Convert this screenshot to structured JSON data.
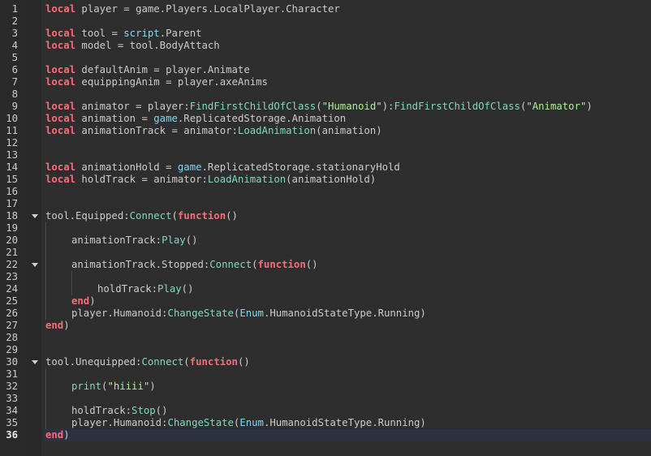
{
  "editor": {
    "current_line": 36,
    "colors": {
      "keyword": "#f86d7c",
      "method": "#84d6c4",
      "builtin": "#84d6f7",
      "string": "#adf195",
      "text": "#cccccc",
      "background": "#2e2e2e"
    },
    "fold_lines": [
      18,
      22,
      30
    ],
    "lines": [
      {
        "n": "1",
        "i": 0,
        "t": [
          [
            "kw",
            "local"
          ],
          [
            "id",
            " player = game.Players.LocalPlayer.Character"
          ]
        ]
      },
      {
        "n": "2",
        "i": 0,
        "t": []
      },
      {
        "n": "3",
        "i": 0,
        "t": [
          [
            "kw",
            "local"
          ],
          [
            "id",
            " tool = "
          ],
          [
            "bi",
            "script"
          ],
          [
            "id",
            ".Parent"
          ]
        ]
      },
      {
        "n": "4",
        "i": 0,
        "t": [
          [
            "kw",
            "local"
          ],
          [
            "id",
            " model = tool.BodyAttach"
          ]
        ]
      },
      {
        "n": "5",
        "i": 0,
        "t": []
      },
      {
        "n": "6",
        "i": 0,
        "t": [
          [
            "kw",
            "local"
          ],
          [
            "id",
            " defaultAnim = player.Animate"
          ]
        ]
      },
      {
        "n": "7",
        "i": 0,
        "t": [
          [
            "kw",
            "local"
          ],
          [
            "id",
            " equippingAnim = player.axeAnims"
          ]
        ]
      },
      {
        "n": "8",
        "i": 0,
        "t": []
      },
      {
        "n": "9",
        "i": 0,
        "t": [
          [
            "kw",
            "local"
          ],
          [
            "id",
            " animator = player:"
          ],
          [
            "fn",
            "FindFirstChildOfClass"
          ],
          [
            "id",
            "("
          ],
          [
            "str",
            "\"Humanoid\""
          ],
          [
            "id",
            "):"
          ],
          [
            "fn",
            "FindFirstChildOfClass"
          ],
          [
            "id",
            "("
          ],
          [
            "str",
            "\"Animator\""
          ],
          [
            "id",
            ")"
          ]
        ]
      },
      {
        "n": "10",
        "i": 0,
        "t": [
          [
            "kw",
            "local"
          ],
          [
            "id",
            " animation = "
          ],
          [
            "bi",
            "game"
          ],
          [
            "id",
            ".ReplicatedStorage.Animation"
          ]
        ]
      },
      {
        "n": "11",
        "i": 0,
        "t": [
          [
            "kw",
            "local"
          ],
          [
            "id",
            " animationTrack = animator:"
          ],
          [
            "fn",
            "LoadAnimation"
          ],
          [
            "id",
            "(animation)"
          ]
        ]
      },
      {
        "n": "12",
        "i": 0,
        "t": []
      },
      {
        "n": "13",
        "i": 0,
        "t": []
      },
      {
        "n": "14",
        "i": 0,
        "t": [
          [
            "kw",
            "local"
          ],
          [
            "id",
            " animationHold = "
          ],
          [
            "bi",
            "game"
          ],
          [
            "id",
            ".ReplicatedStorage.stationaryHold"
          ]
        ]
      },
      {
        "n": "15",
        "i": 0,
        "t": [
          [
            "kw",
            "local"
          ],
          [
            "id",
            " holdTrack = animator:"
          ],
          [
            "fn",
            "LoadAnimation"
          ],
          [
            "id",
            "(animationHold)"
          ]
        ]
      },
      {
        "n": "16",
        "i": 0,
        "t": []
      },
      {
        "n": "17",
        "i": 0,
        "t": []
      },
      {
        "n": "18",
        "i": 0,
        "t": [
          [
            "id",
            "tool.Equipped:"
          ],
          [
            "fn",
            "Connect"
          ],
          [
            "id",
            "("
          ],
          [
            "kw",
            "function"
          ],
          [
            "id",
            "()"
          ]
        ]
      },
      {
        "n": "19",
        "i": 0,
        "t": []
      },
      {
        "n": "20",
        "i": 1,
        "t": [
          [
            "id",
            "animationTrack:"
          ],
          [
            "fn",
            "Play"
          ],
          [
            "id",
            "()"
          ]
        ]
      },
      {
        "n": "21",
        "i": 0,
        "t": []
      },
      {
        "n": "22",
        "i": 1,
        "t": [
          [
            "id",
            "animationTrack.Stopped:"
          ],
          [
            "fn",
            "Connect"
          ],
          [
            "id",
            "("
          ],
          [
            "kw",
            "function"
          ],
          [
            "id",
            "()"
          ]
        ]
      },
      {
        "n": "23",
        "i": 0,
        "t": []
      },
      {
        "n": "24",
        "i": 2,
        "t": [
          [
            "id",
            "holdTrack:"
          ],
          [
            "fn",
            "Play"
          ],
          [
            "id",
            "()"
          ]
        ]
      },
      {
        "n": "25",
        "i": 1,
        "t": [
          [
            "kw",
            "end"
          ],
          [
            "id",
            ")"
          ]
        ]
      },
      {
        "n": "26",
        "i": 1,
        "t": [
          [
            "id",
            "player.Humanoid:"
          ],
          [
            "fn",
            "ChangeState"
          ],
          [
            "id",
            "("
          ],
          [
            "bi",
            "Enum"
          ],
          [
            "id",
            ".HumanoidStateType.Running)"
          ]
        ]
      },
      {
        "n": "27",
        "i": 0,
        "t": [
          [
            "kw",
            "end"
          ],
          [
            "id",
            ")"
          ]
        ]
      },
      {
        "n": "28",
        "i": 0,
        "t": []
      },
      {
        "n": "29",
        "i": 0,
        "t": []
      },
      {
        "n": "30",
        "i": 0,
        "t": [
          [
            "id",
            "tool.Unequipped:"
          ],
          [
            "fn",
            "Connect"
          ],
          [
            "id",
            "("
          ],
          [
            "kw",
            "function"
          ],
          [
            "id",
            "()"
          ]
        ]
      },
      {
        "n": "31",
        "i": 0,
        "t": []
      },
      {
        "n": "32",
        "i": 1,
        "t": [
          [
            "fn",
            "print"
          ],
          [
            "id",
            "("
          ],
          [
            "str",
            "\"hiiii\""
          ],
          [
            "id",
            ")"
          ]
        ]
      },
      {
        "n": "33",
        "i": 0,
        "t": []
      },
      {
        "n": "34",
        "i": 1,
        "t": [
          [
            "id",
            "holdTrack:"
          ],
          [
            "fn",
            "Stop"
          ],
          [
            "id",
            "()"
          ]
        ]
      },
      {
        "n": "35",
        "i": 1,
        "t": [
          [
            "id",
            "player.Humanoid:"
          ],
          [
            "fn",
            "ChangeState"
          ],
          [
            "id",
            "("
          ],
          [
            "bi",
            "Enum"
          ],
          [
            "id",
            ".HumanoidStateType.Running)"
          ]
        ]
      },
      {
        "n": "36",
        "i": 0,
        "t": [
          [
            "kw",
            "end"
          ],
          [
            "id",
            ")"
          ]
        ]
      }
    ]
  }
}
